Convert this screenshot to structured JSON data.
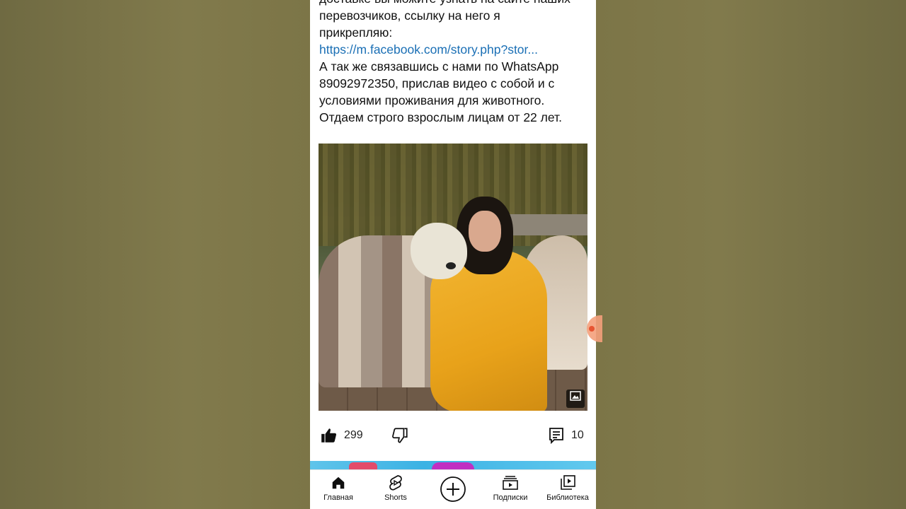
{
  "post": {
    "lines": [
      "доставке вы можите узнать на сайте наших",
      "перевозчиков, ссылку на него я",
      "прикрепляю:",
      "https://m.facebook.com/story.php?stor...",
      "А так же связавшись с нами по WhatsApp",
      "89092972350, прислав видео с собой и с",
      "условиями проживания для животного.",
      "Отдаем строго взрослым лицам от 22 лет."
    ]
  },
  "actions": {
    "likes": "299",
    "comments": "10"
  },
  "nav": {
    "home": "Главная",
    "shorts": "Shorts",
    "subscriptions": "Подписки",
    "library": "Библиотека"
  },
  "colors": {
    "link": "#1a6fb5",
    "background": "#7b7446"
  },
  "icons": {
    "like": "thumbs-up-icon",
    "dislike": "thumbs-down-icon",
    "comment": "comment-icon",
    "home": "home-icon",
    "shorts": "shorts-icon",
    "add": "plus-circle-icon",
    "subscriptions": "subscriptions-icon",
    "library": "library-icon",
    "gallery": "gallery-icon"
  }
}
